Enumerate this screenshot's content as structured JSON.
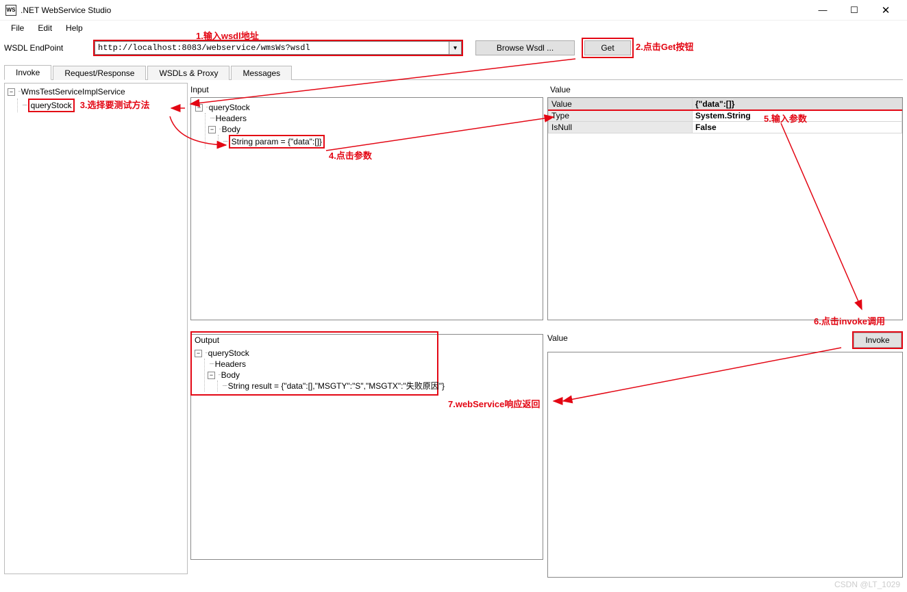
{
  "title": ".NET WebService Studio",
  "appicon": "WS",
  "win": {
    "min": "—",
    "max": "☐",
    "close": "✕"
  },
  "menu": [
    "File",
    "Edit",
    "Help"
  ],
  "endpoint": {
    "label": "WSDL EndPoint",
    "url": "http://localhost:8083/webservice/wmsWs?wsdl",
    "browse": "Browse Wsdl ...",
    "get": "Get"
  },
  "tabs": [
    "Invoke",
    "Request/Response",
    "WSDLs & Proxy",
    "Messages"
  ],
  "active_tab": 0,
  "lefttree": {
    "root": "WmsTestServiceImplService",
    "method": "queryStock"
  },
  "input": {
    "label": "Input",
    "root": "queryStock",
    "headers": "Headers",
    "body": "Body",
    "param": "String param = {\"data\":[]}"
  },
  "valuegrid": {
    "label": "Value",
    "rows": [
      {
        "name": "Value",
        "val": "{\"data\":[]}"
      },
      {
        "name": "Type",
        "val": "System.String"
      },
      {
        "name": "IsNull",
        "val": "False"
      }
    ]
  },
  "output": {
    "label": "Output",
    "root": "queryStock",
    "headers": "Headers",
    "body": "Body",
    "result": "String result = {\"data\":[],\"MSGTY\":\"S\",\"MSGTX\":\"失败原因\"}"
  },
  "value2label": "Value",
  "invoke_label": "Invoke",
  "ann": {
    "a1": "1.输入wsdl地址",
    "a2": "2.点击Get按钮",
    "a3": "3.选择要测试方法",
    "a4": "4.点击参数",
    "a5": "5.输入参数",
    "a6": "6.点击invoke调用",
    "a7": "7.webService响应返回"
  },
  "watermark": "CSDN @LT_1029"
}
